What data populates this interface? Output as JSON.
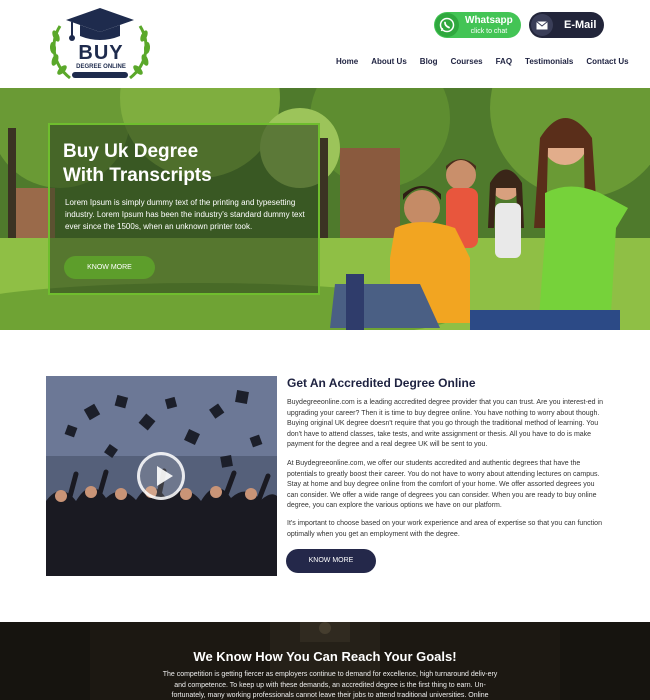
{
  "brand": {
    "logo_main": "BUY",
    "logo_sub": "DEGREE ONLINE"
  },
  "contact": {
    "whatsapp_label": "Whatsapp",
    "whatsapp_sub": "click to chat",
    "email_label": "E-Mail"
  },
  "nav": {
    "items": [
      {
        "label": "Home"
      },
      {
        "label": "About Us"
      },
      {
        "label": "Blog"
      },
      {
        "label": "Courses"
      },
      {
        "label": "FAQ"
      },
      {
        "label": "Testimonials"
      },
      {
        "label": "Contact Us"
      }
    ]
  },
  "hero": {
    "title_line1": "Buy Uk Degree",
    "title_line2": "With Transcripts",
    "text": "Lorem Ipsum is simply dummy text of the printing and typesetting industry. Lorem Ipsum has been the industry's standard dummy text ever since the 1500s, when an unknown printer took.",
    "button": "KNOW MORE"
  },
  "about": {
    "title": "Get An Accredited Degree Online",
    "p1": "Buydegreeonline.com is a leading accredited degree provider that you can trust. Are you interest-ed in upgrading your career? Then it is time to buy degree online. You have nothing to worry about though. Buying original UK degree doesn't require that you go through the traditional method of learning. You don't have to attend classes, take tests, and write assignment or thesis. All you have to do is make payment for the degree and a real degree UK will be sent to you.",
    "p2": "At Buydegreeonline.com, we offer our students accredited and authentic degrees that have the potentials to greatly boost their career. You do not have to worry about attending lectures on campus. Stay at home and buy degree online from the comfort of your home. We offer assorted degrees you can consider. We offer a wide range of degrees you can consider. When you are ready to buy online degree, you can explore the various options we have on our platform.",
    "p3": "It's important to choose based on your work experience and area of expertise so that you can function optimally when you get an employment with the degree.",
    "button": "KNOW MORE"
  },
  "goals": {
    "title": "We Know How You Can Reach Your Goals!",
    "text": "The competition is getting fiercer as employers continue to demand for excellence, high turnaround deliv-ery and competence. To keep up with these demands, an accredited degree is the first thing to earn. Un-fortunately, many working professionals cannot leave their jobs to attend traditional universities. Online"
  },
  "icons": {
    "whatsapp": "whatsapp-icon",
    "email": "envelope-icon",
    "play": "play-icon",
    "logo": "graduation-cap-icon"
  },
  "colors": {
    "accent_green": "#5d9e2b",
    "navy": "#24284a",
    "whatsapp_green": "#43c455"
  }
}
